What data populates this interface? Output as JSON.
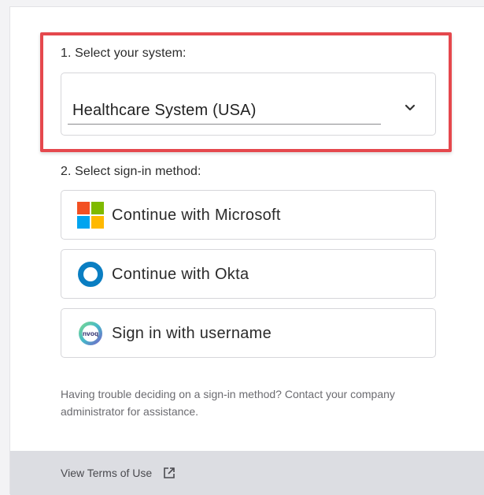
{
  "step1": {
    "label": "1. Select your system:",
    "selected_value": "Healthcare System (USA)"
  },
  "step2": {
    "label": "2. Select sign-in method:",
    "methods": [
      {
        "label": "Continue with Microsoft",
        "icon": "microsoft-logo-icon"
      },
      {
        "label": "Continue with Okta",
        "icon": "okta-logo-icon"
      },
      {
        "label": "Sign in with username",
        "icon": "nvoq-logo-icon"
      }
    ]
  },
  "help": {
    "text": "Having trouble deciding on a sign-in method? Contact your company administrator for assistance."
  },
  "footer": {
    "link_label": "View Terms of Use",
    "link_icon": "external-link-icon"
  },
  "colors": {
    "highlight": "#e5484d",
    "microsoft": [
      "#f25022",
      "#7fba00",
      "#00a4ef",
      "#ffb900"
    ],
    "okta": "#0a7ec2",
    "footer_bg": "#dcdde2"
  },
  "icons": {
    "nvoq_logo_text": "nvoq"
  }
}
